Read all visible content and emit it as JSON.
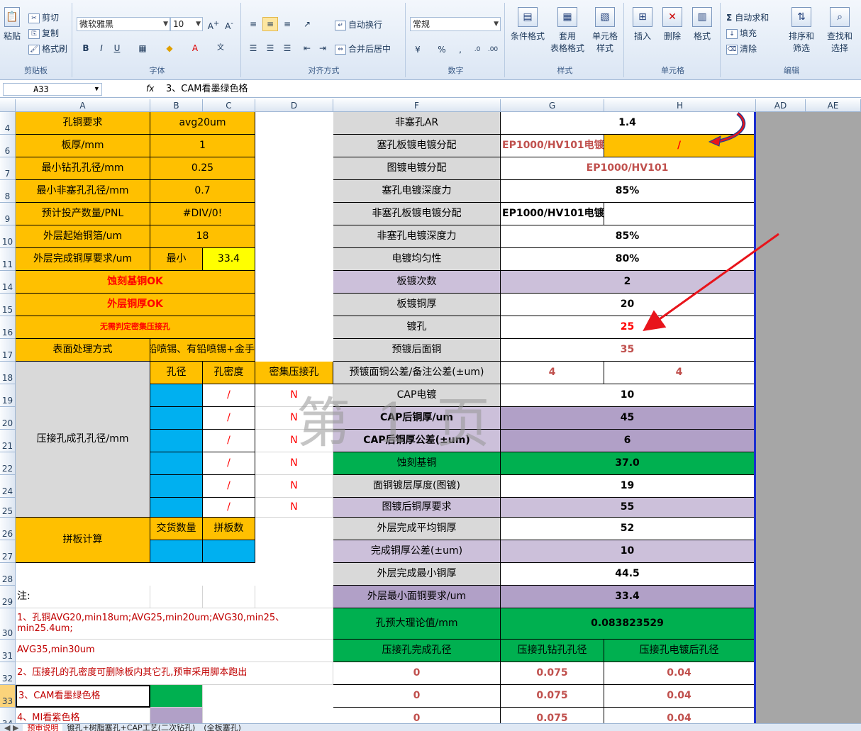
{
  "ribbon": {
    "clipboard": {
      "paste": "粘贴",
      "cut": "剪切",
      "copy": "复制",
      "format_painter": "格式刷",
      "label": "剪贴板"
    },
    "font": {
      "name": "微软雅黑",
      "size": "10",
      "label": "字体"
    },
    "alignment": {
      "wrap": "自动换行",
      "merge": "合并后居中",
      "label": "对齐方式"
    },
    "number": {
      "format": "常规",
      "label": "数字"
    },
    "styles": {
      "conditional": "条件格式",
      "table_line1": "套用",
      "table_line2": "表格格式",
      "cell_line1": "单元格",
      "cell_line2": "样式",
      "label": "样式"
    },
    "cells": {
      "insert": "插入",
      "delete": "删除",
      "format": "格式",
      "label": "单元格"
    },
    "editing": {
      "autosum": "自动求和",
      "fill": "填充",
      "clear": "清除",
      "sort_line1": "排序和",
      "sort_line2": "筛选",
      "find_line1": "查找和",
      "find_line2": "选择",
      "label": "编辑"
    }
  },
  "formula_bar": {
    "name_box": "A33",
    "fx": "fx",
    "formula": "3、CAM看墨绿色格"
  },
  "columns": {
    "A": "A",
    "B": "B",
    "C": "C",
    "D": "D",
    "F": "F",
    "G": "G",
    "H": "H",
    "AD": "AD",
    "AE": "AE"
  },
  "rows": {
    "r4": "4",
    "r6": "6",
    "r7": "7",
    "r8": "8",
    "r9": "9",
    "r10": "10",
    "r11": "11",
    "r14": "14",
    "r15": "15",
    "r16": "16",
    "r17": "17",
    "r18": "18",
    "r19": "19",
    "r20": "20",
    "r21": "21",
    "r22": "22",
    "r24": "24",
    "r25": "25",
    "r26": "26",
    "r27": "27",
    "r28": "28",
    "r29": "29",
    "r30": "30",
    "r31": "31",
    "r32": "32",
    "r33": "33",
    "r34": "34"
  },
  "left": {
    "hole_copper_label": "孔铜要求",
    "hole_copper_val": "avg20um",
    "board_thick_label": "板厚/mm",
    "board_thick_val": "1",
    "min_drill_label": "最小钻孔孔径/mm",
    "min_drill_val": "0.25",
    "min_nonplug_label": "最小非塞孔孔径/mm",
    "min_nonplug_val": "0.7",
    "qty_label": "预计投产数量/PNL",
    "qty_val": "#DIV/0!",
    "start_foil_label": "外层起始铜箔/um",
    "start_foil_val": "18",
    "outer_finish_label": "外层完成铜厚要求/um",
    "outer_finish_min": "最小",
    "outer_finish_val": "33.4",
    "etch_ok": "蚀刻基铜OK",
    "outer_ok": "外层铜厚OK",
    "no_press": "无需判定密集压接孔",
    "surface_label": "表面处理方式",
    "surface_val": "铅喷锡、有铅喷锡+金手",
    "press_header_hole": "孔径",
    "press_header_density": "孔密度",
    "press_header_dense": "密集压接孔",
    "press_label": "压接孔成孔孔径/mm",
    "press_rows": [
      {
        "density": "/",
        "dense": "N"
      },
      {
        "density": "/",
        "dense": "N"
      },
      {
        "density": "/",
        "dense": "N"
      },
      {
        "density": "/",
        "dense": "N"
      },
      {
        "density": "/",
        "dense": "N"
      },
      {
        "density": "/",
        "dense": "N"
      }
    ],
    "panel_label": "拼板计算",
    "panel_qty": "交货数量",
    "panel_count": "拼板数",
    "note_label": "注:",
    "note1": "1、孔铜AVG20,min18um;AVG25,min20um;AVG30,min25、",
    "note1b": "min25.4um;",
    "note1c": "AVG35,min30um",
    "note2": "2、压接孔的孔密度可删除板内其它孔,预审采用脚本跑出",
    "note3": "3、CAM看墨绿色格",
    "note4": "4、MI看紫色格"
  },
  "right": {
    "nonplug_ar_label": "非塞孔AR",
    "nonplug_ar_val": "1.4",
    "plug_dist_label": "塞孔板镀电镀分配",
    "plug_dist_g": "EP1000/HV101电镀",
    "plug_dist_h": "/",
    "img_dist_label": "图镀电镀分配",
    "img_dist_val": "EP1000/HV101",
    "plug_depth_label": "塞孔电镀深度力",
    "plug_depth_val": "85%",
    "nonplug_dist_label": "非塞孔板镀电镀分配",
    "nonplug_dist_val": "EP1000/HV101电镀",
    "nonplug_depth_label": "非塞孔电镀深度力",
    "nonplug_depth_val": "85%",
    "uniform_label": "电镀均匀性",
    "uniform_val": "80%",
    "plate_times_label": "板镀次数",
    "plate_times_val": "2",
    "plate_thick_label": "板镀铜厚",
    "plate_thick_val": "20",
    "hole_plate_label": "镀孔",
    "hole_plate_val": "25",
    "pre_surface_label": "预镀后面铜",
    "pre_surface_val": "35",
    "pre_tol_label": "预镀面铜公差/备注公差(±um)",
    "pre_tol_g": "4",
    "pre_tol_h": "4",
    "cap_plate_label": "CAP电镀",
    "cap_plate_val": "10",
    "cap_after_label": "CAP后铜厚/um",
    "cap_after_val": "45",
    "cap_tol_label": "CAP后铜厚公差(±um)",
    "cap_tol_val": "6",
    "etch_base_label": "蚀刻基铜",
    "etch_base_val": "37.0",
    "surf_layer_label": "面铜镀层厚度(图镀)",
    "surf_layer_val": "19",
    "img_after_label": "图镀后铜厚要求",
    "img_after_val": "55",
    "outer_avg_label": "外层完成平均铜厚",
    "outer_avg_val": "52",
    "finish_tol_label": "完成铜厚公差(±um)",
    "finish_tol_val": "10",
    "outer_min_label": "外层完成最小铜厚",
    "outer_min_val": "44.5",
    "outer_min_req_label": "外层最小面铜要求/um",
    "outer_min_req_val": "33.4",
    "pre_theory_label": "孔预大理论值/mm",
    "pre_theory_val": "0.083823529",
    "press_finish_label": "压接孔完成孔径",
    "press_drill_label": "压接孔钻孔孔径",
    "press_after_label": "压接孔电镀后孔径",
    "press_table": [
      {
        "f": "0",
        "g": "0.075",
        "h": "0.04"
      },
      {
        "f": "0",
        "g": "0.075",
        "h": "0.04"
      },
      {
        "f": "0",
        "g": "0.075",
        "h": "0.04"
      }
    ]
  },
  "watermark": "第 1 页",
  "tabs": [
    "镀孔+树脂塞孔+CAP工艺(二次钻孔)",
    "(全板塞孔)"
  ],
  "tab_current": "预审说明"
}
